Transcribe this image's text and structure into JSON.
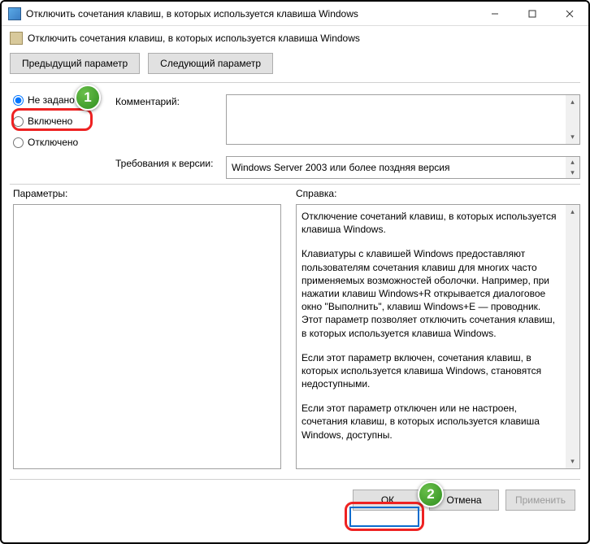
{
  "window": {
    "title": "Отключить сочетания клавиш, в которых используется клавиша Windows"
  },
  "toolbar": {
    "policy_name": "Отключить сочетания клавиш, в которых используется клавиша Windows"
  },
  "nav": {
    "prev": "Предыдущий параметр",
    "next": "Следующий параметр"
  },
  "radios": {
    "not_configured": "Не задано",
    "enabled": "Включено",
    "disabled": "Отключено",
    "selected": "not_configured"
  },
  "fields": {
    "comment_label": "Комментарий:",
    "comment_value": "",
    "requirements_label": "Требования к версии:",
    "requirements_value": "Windows Server 2003 или более поздняя версия"
  },
  "panels": {
    "params_label": "Параметры:",
    "help_label": "Справка:",
    "help": {
      "p1": "Отключение сочетаний клавиш, в которых используется клавиша Windows.",
      "p2": "Клавиатуры с клавишей Windows предоставляют пользователям сочетания клавиш для многих часто применяемых возможностей оболочки. Например, при нажатии клавиш Windows+R открывается диалоговое окно \"Выполнить\", клавиш Windows+E — проводник. Этот параметр позволяет отключить сочетания клавиш, в которых используется клавиша Windows.",
      "p3": "Если этот параметр включен, сочетания клавиш, в которых используется клавиша Windows, становятся недоступными.",
      "p4": "Если этот параметр отключен или не настроен, сочетания клавиш, в которых используется клавиша Windows, доступны."
    }
  },
  "footer": {
    "ok": "ОК",
    "cancel": "Отмена",
    "apply": "Применить"
  },
  "annotations": {
    "badge1": "1",
    "badge2": "2"
  }
}
